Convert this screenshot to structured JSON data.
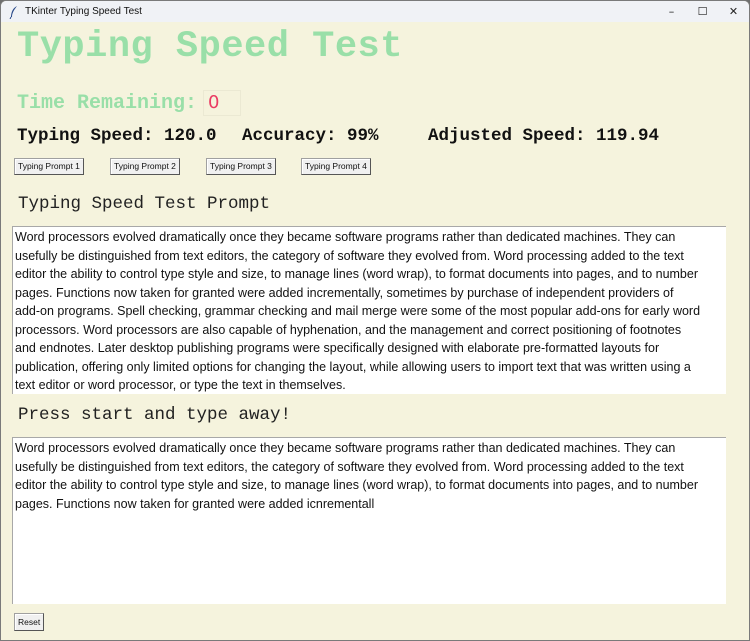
{
  "window": {
    "title": "TKinter Typing Speed Test",
    "app_icon": "feather-icon",
    "controls": {
      "minimize": "–",
      "maximize": "☐",
      "close": "✕"
    }
  },
  "header": {
    "title": "Typing Speed Test"
  },
  "timer": {
    "label": "Time Remaining:",
    "value": "0"
  },
  "stats": {
    "typing_speed": "Typing Speed: 120.0",
    "accuracy": "Accuracy: 99%",
    "adjusted_speed": "Adjusted Speed: 119.94"
  },
  "prompt_buttons": [
    {
      "label": "Typing Prompt 1"
    },
    {
      "label": "Typing Prompt 2"
    },
    {
      "label": "Typing Prompt 3"
    },
    {
      "label": "Typing Prompt 4"
    }
  ],
  "prompt_section": {
    "heading": "Typing Speed Test Prompt",
    "lines": [
      "Word processors evolved dramatically once they became software programs rather than dedicated machines. They can",
      "usefully be distinguished from text editors, the category of software they evolved from. Word processing added to the text",
      "editor the ability to control type style and size, to manage lines (word wrap), to format documents into pages, and to number",
      "pages. Functions now taken for granted were added incrementally, sometimes by purchase of independent providers of",
      "add-on programs. Spell checking, grammar checking and mail merge were some of the most popular add-ons for early word",
      "processors. Word processors are also capable of hyphenation, and the management and correct positioning of footnotes",
      "and endnotes. Later desktop publishing programs were specifically designed with elaborate pre-formatted layouts for",
      "publication, offering only limited options for changing the layout, while allowing users to import text that was written using a",
      "text editor or word processor, or type the text in themselves."
    ]
  },
  "typing_section": {
    "heading": "Press start and type away!",
    "lines": [
      "Word processors evolved dramatically once they became software programs rather than dedicated machines. They can",
      "usefully be distinguished from text editors, the category of software they evolved from. Word processing added to the text",
      "editor the ability to control type style and size, to manage lines (word wrap), to format documents into pages, and to number",
      "pages. Functions now taken for granted were added icnrementall"
    ]
  },
  "footer": {
    "reset_label": "Reset"
  },
  "colors": {
    "background": "#f5f3dd",
    "title_green": "#99dfa8",
    "timer_red": "#ea3b62"
  }
}
